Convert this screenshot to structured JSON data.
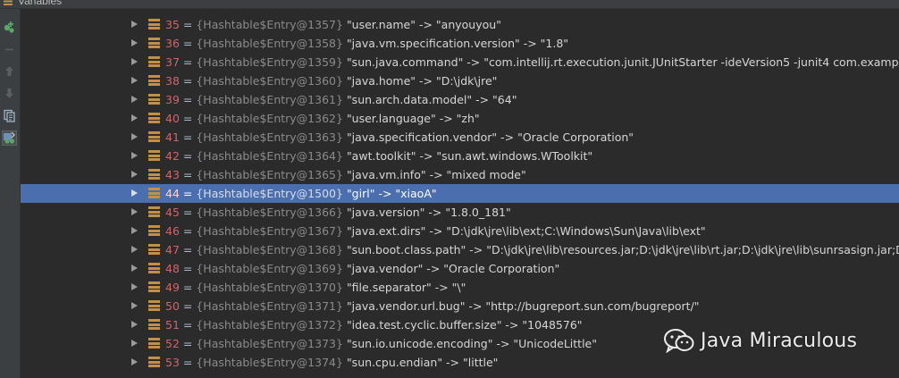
{
  "panel": {
    "title": "Variables"
  },
  "toolbar": {
    "buttons": [
      {
        "icon": "add-watch-icon",
        "state": "enabled"
      },
      {
        "icon": "remove-icon",
        "state": "disabled"
      },
      {
        "icon": "arrow-up-icon",
        "state": "disabled"
      },
      {
        "icon": "arrow-down-icon",
        "state": "disabled"
      },
      {
        "icon": "copy-icon",
        "state": "enabled"
      },
      {
        "icon": "watches-icon",
        "state": "active"
      }
    ]
  },
  "rows": [
    {
      "index": "35",
      "eq": "=",
      "ref": "{Hashtable$Entry@1357}",
      "kv": "\"user.name\" -> \"anyouyou\"",
      "selected": false
    },
    {
      "index": "36",
      "eq": "=",
      "ref": "{Hashtable$Entry@1358}",
      "kv": "\"java.vm.specification.version\" -> \"1.8\"",
      "selected": false
    },
    {
      "index": "37",
      "eq": "=",
      "ref": "{Hashtable$Entry@1359}",
      "kv": "\"sun.java.command\" -> \"com.intellij.rt.execution.junit.JUnitStarter -ideVersion5 -junit4 com.example.demo.spring",
      "selected": false
    },
    {
      "index": "38",
      "eq": "=",
      "ref": "{Hashtable$Entry@1360}",
      "kv": "\"java.home\" -> \"D:\\jdk\\jre\"",
      "selected": false
    },
    {
      "index": "39",
      "eq": "=",
      "ref": "{Hashtable$Entry@1361}",
      "kv": "\"sun.arch.data.model\" -> \"64\"",
      "selected": false
    },
    {
      "index": "40",
      "eq": "=",
      "ref": "{Hashtable$Entry@1362}",
      "kv": "\"user.language\" -> \"zh\"",
      "selected": false
    },
    {
      "index": "41",
      "eq": "=",
      "ref": "{Hashtable$Entry@1363}",
      "kv": "\"java.specification.vendor\" -> \"Oracle Corporation\"",
      "selected": false
    },
    {
      "index": "42",
      "eq": "=",
      "ref": "{Hashtable$Entry@1364}",
      "kv": "\"awt.toolkit\" -> \"sun.awt.windows.WToolkit\"",
      "selected": false
    },
    {
      "index": "43",
      "eq": "=",
      "ref": "{Hashtable$Entry@1365}",
      "kv": "\"java.vm.info\" -> \"mixed mode\"",
      "selected": false
    },
    {
      "index": "44",
      "eq": "=",
      "ref": "{Hashtable$Entry@1500}",
      "kv": "\"girl\" -> \"xiaoA\"",
      "selected": true
    },
    {
      "index": "45",
      "eq": "=",
      "ref": "{Hashtable$Entry@1366}",
      "kv": "\"java.version\" -> \"1.8.0_181\"",
      "selected": false
    },
    {
      "index": "46",
      "eq": "=",
      "ref": "{Hashtable$Entry@1367}",
      "kv": "\"java.ext.dirs\" -> \"D:\\jdk\\jre\\lib\\ext;C:\\Windows\\Sun\\Java\\lib\\ext\"",
      "selected": false
    },
    {
      "index": "47",
      "eq": "=",
      "ref": "{Hashtable$Entry@1368}",
      "kv": "\"sun.boot.class.path\" -> \"D:\\jdk\\jre\\lib\\resources.jar;D:\\jdk\\jre\\lib\\rt.jar;D:\\jdk\\jre\\lib\\sunrsasign.jar;D:\\jdk\\jre\\lib\\",
      "selected": false
    },
    {
      "index": "48",
      "eq": "=",
      "ref": "{Hashtable$Entry@1369}",
      "kv": "\"java.vendor\" -> \"Oracle Corporation\"",
      "selected": false
    },
    {
      "index": "49",
      "eq": "=",
      "ref": "{Hashtable$Entry@1370}",
      "kv": "\"file.separator\" -> \"\\\"",
      "selected": false
    },
    {
      "index": "50",
      "eq": "=",
      "ref": "{Hashtable$Entry@1371}",
      "kv": "\"java.vendor.url.bug\" -> \"http://bugreport.sun.com/bugreport/\"",
      "selected": false
    },
    {
      "index": "51",
      "eq": "=",
      "ref": "{Hashtable$Entry@1372}",
      "kv": "\"idea.test.cyclic.buffer.size\" -> \"1048576\"",
      "selected": false
    },
    {
      "index": "52",
      "eq": "=",
      "ref": "{Hashtable$Entry@1373}",
      "kv": "\"sun.io.unicode.encoding\" -> \"UnicodeLittle\"",
      "selected": false
    },
    {
      "index": "53",
      "eq": "=",
      "ref": "{Hashtable$Entry@1374}",
      "kv": "\"sun.cpu.endian\" -> \"little\"",
      "selected": false
    }
  ],
  "watermark": {
    "text": "Java Miraculous",
    "logo": "wechat-logo"
  },
  "colors": {
    "background": "#2b2b2b",
    "selection": "#4b6eaf",
    "index": "#cc666e",
    "entry_icon": "#c29048"
  }
}
